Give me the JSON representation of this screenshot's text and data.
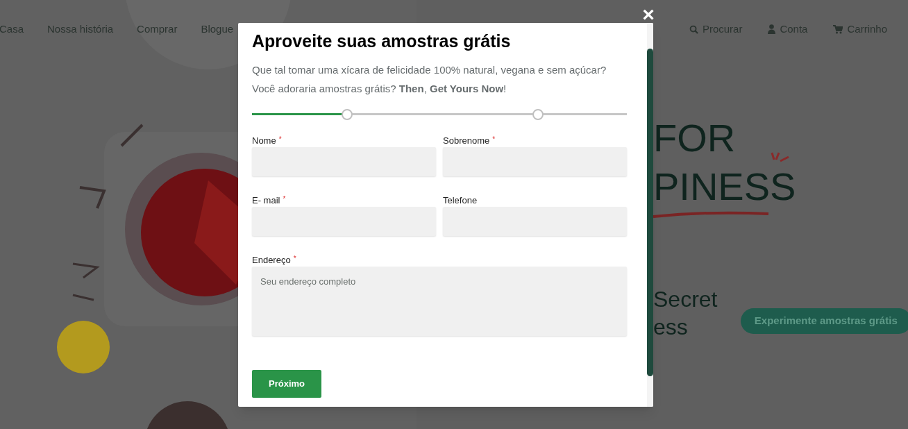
{
  "nav": {
    "links": [
      {
        "label": "Casa"
      },
      {
        "label": "Nossa história"
      },
      {
        "label": "Comprar"
      },
      {
        "label": "Blogue"
      }
    ],
    "actions": [
      {
        "kind": "search",
        "label": "Procurar"
      },
      {
        "kind": "account",
        "label": "Conta"
      },
      {
        "kind": "cart",
        "label": "Carrinho"
      }
    ]
  },
  "hero": {
    "headline_lines": [
      "FOR",
      "PINESS"
    ],
    "subtitle_lines": [
      "Secret",
      "ess"
    ],
    "cta": "Experimente amostras grátis"
  },
  "modal": {
    "close": "×",
    "title": "Aproveite suas amostras grátis",
    "description_lines": [
      "Que tal tomar uma xícara de felicidade 100% natural, vegana e sem açúcar?",
      "Você adoraria amostras grátis? **Then**, **Get Yours Now**!"
    ],
    "progress": {
      "level": 0.25
    },
    "fields": [
      {
        "kind": "input",
        "label": "Nome",
        "required_mark": "*"
      },
      {
        "kind": "input",
        "label": "Sobrenome",
        "required_mark": "*"
      },
      {
        "kind": "input",
        "label": "E- mail",
        "required_mark": "*"
      },
      {
        "kind": "input",
        "label": "Telefone"
      },
      {
        "kind": "textarea",
        "label": "Endereço",
        "required_mark": "*",
        "placeholder": "Seu endereço completo"
      }
    ],
    "submit": "Próximo"
  }
}
